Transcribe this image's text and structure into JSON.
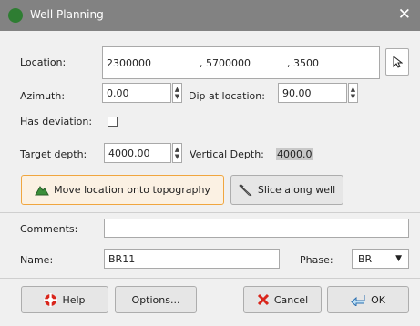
{
  "window": {
    "title": "Well Planning",
    "close_glyph": "✕"
  },
  "location": {
    "label": "Location:",
    "x": "2300000",
    "y": ", 5700000",
    "z": ", 3500"
  },
  "azimuth": {
    "label": "Azimuth:",
    "value": "0.00"
  },
  "dip": {
    "label": "Dip at location:",
    "value": "90.00"
  },
  "deviation": {
    "label": "Has deviation:",
    "checked": false
  },
  "target_depth": {
    "label": "Target depth:",
    "value": "4000.00"
  },
  "vertical_depth": {
    "label": "Vertical Depth:",
    "value": "4000.0"
  },
  "buttons": {
    "move": "Move location onto topography",
    "slice": "Slice along well",
    "help": "Help",
    "options": "Options...",
    "cancel": "Cancel",
    "ok": "OK"
  },
  "comments": {
    "label": "Comments:",
    "value": ""
  },
  "name": {
    "label": "Name:",
    "value": "BR11"
  },
  "phase": {
    "label": "Phase:",
    "value": "BR"
  }
}
